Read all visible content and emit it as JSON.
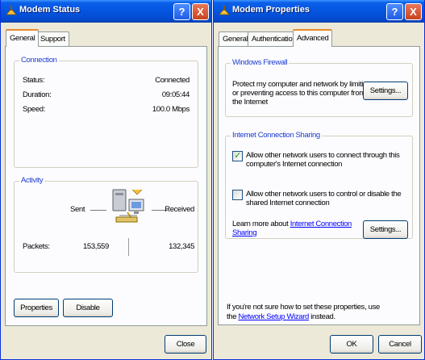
{
  "status_window": {
    "title": "Modem Status",
    "tabs": [
      "General",
      "Support"
    ],
    "connection": {
      "legend": "Connection",
      "rows": [
        {
          "label": "Status:",
          "value": "Connected"
        },
        {
          "label": "Duration:",
          "value": "09:05:44"
        },
        {
          "label": "Speed:",
          "value": "100.0 Mbps"
        }
      ]
    },
    "activity": {
      "legend": "Activity",
      "sent_label": "Sent",
      "received_label": "Received",
      "packets_label": "Packets:",
      "sent_value": "153,559",
      "received_value": "132,345"
    },
    "properties_button": "Properties",
    "disable_button": "Disable",
    "close_button": "Close"
  },
  "props_window": {
    "title": "Modem Properties",
    "tabs": [
      "General",
      "Authentication",
      "Advanced"
    ],
    "firewall": {
      "legend": "Windows Firewall",
      "line1": "Protect my computer and network by limiting",
      "line2": "or preventing access to this computer from",
      "line3": "the Internet",
      "settings_button": "Settings..."
    },
    "ics": {
      "legend": "Internet Connection Sharing",
      "allow_connect_1": "Allow other network users to connect through this",
      "allow_connect_2": "computer's Internet connection",
      "allow_connect_checked": true,
      "allow_control_1": "Allow other network users to control or disable the",
      "allow_control_2": "shared Internet connection",
      "allow_control_checked": false,
      "learn_more_prefix": "Learn more about ",
      "learn_more_link_1": "Internet Connection",
      "learn_more_link_2": "Sharing",
      "settings_button": "Settings..."
    },
    "footer": {
      "line1": "If you're not sure how to set these properties, use",
      "line2_prefix": "the ",
      "line2_link": "Network Setup Wizard",
      "line2_suffix": " instead."
    },
    "ok_button": "OK",
    "cancel_button": "Cancel"
  },
  "titlebar_buttons": {
    "help": "?",
    "close": "X"
  },
  "icons": {
    "check": "✓"
  }
}
